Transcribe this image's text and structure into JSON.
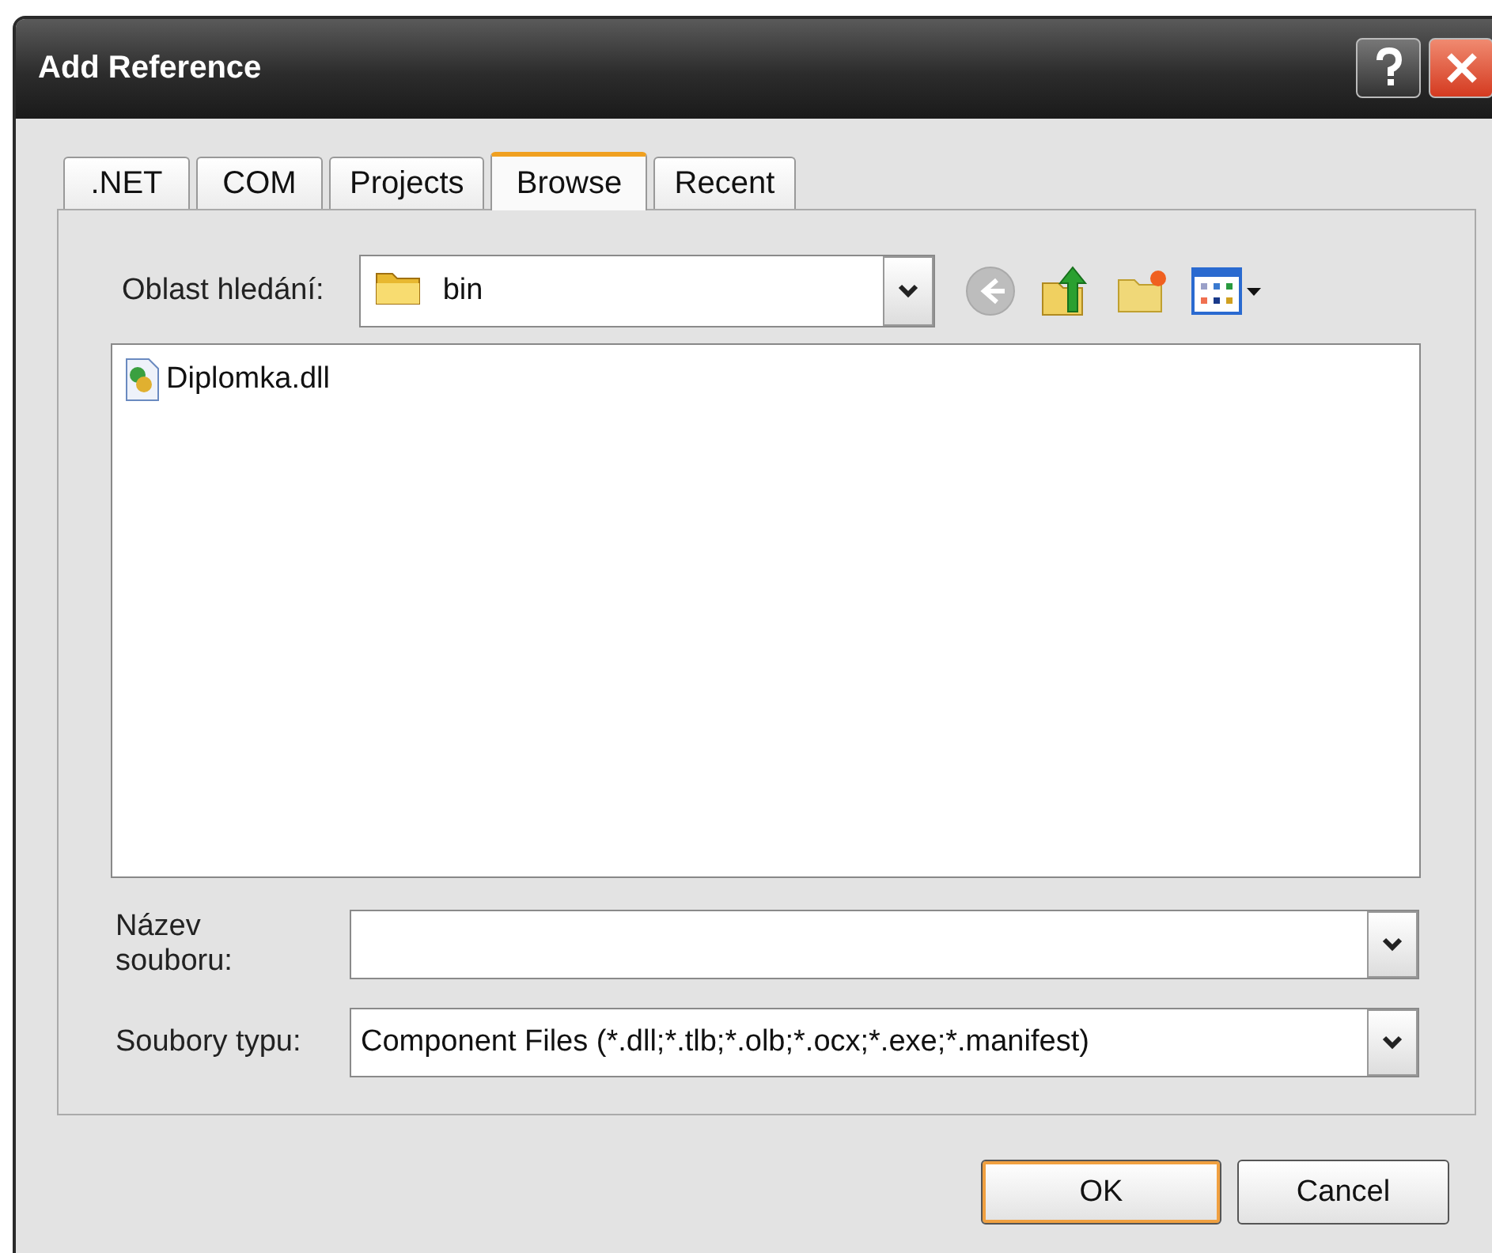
{
  "window": {
    "title": "Add Reference"
  },
  "tabs": [
    {
      "label": ".NET",
      "selected": false
    },
    {
      "label": "COM",
      "selected": false
    },
    {
      "label": "Projects",
      "selected": false
    },
    {
      "label": "Browse",
      "selected": true
    },
    {
      "label": "Recent",
      "selected": false
    }
  ],
  "look_in": {
    "label": "Oblast hledání:",
    "value": "bin"
  },
  "files": [
    {
      "name": "Diplomka.dll"
    }
  ],
  "file_name": {
    "label": "Název souboru:"
  },
  "file_type": {
    "label": "Soubory typu:",
    "value": "Component Files (*.dll;*.tlb;*.olb;*.ocx;*.exe;*.manifest)"
  },
  "buttons": [
    {
      "label": "OK",
      "kind": "default"
    },
    {
      "label": "Cancel",
      "kind": "normal"
    }
  ]
}
